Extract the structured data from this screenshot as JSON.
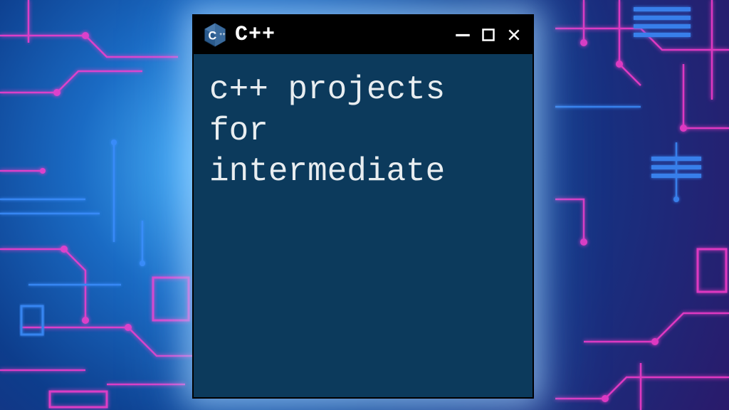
{
  "window": {
    "title": "C++",
    "logo_letter": "C",
    "logo_plus": "++",
    "body_text": "c++ projects for intermediate"
  },
  "colors": {
    "window_bg": "#0c3a5c",
    "titlebar_bg": "#000000",
    "text": "#e8edf0",
    "logo_bg": "#2a5a8c",
    "circuit_blue": "#3d8fff",
    "circuit_pink": "#ff3dcf"
  }
}
